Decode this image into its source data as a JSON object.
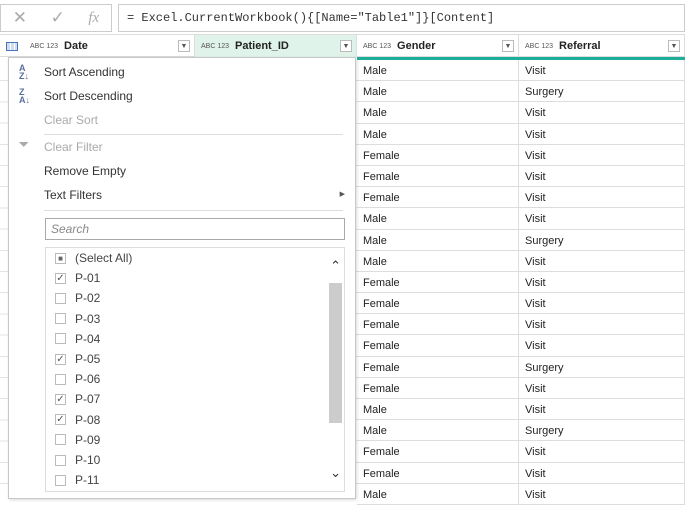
{
  "formula_bar": {
    "cancel": "✕",
    "confirm": "✓",
    "fx": "fx",
    "formula": "= Excel.CurrentWorkbook(){[Name=\"Table1\"]}[Content]"
  },
  "columns": [
    {
      "label": "Date",
      "type": "ABC 123"
    },
    {
      "label": "Patient_ID",
      "type": "ABC 123"
    },
    {
      "label": "Gender",
      "type": "ABC 123"
    },
    {
      "label": "Referral",
      "type": "ABC 123"
    }
  ],
  "menu": {
    "sort_asc": "Sort Ascending",
    "sort_desc": "Sort Descending",
    "clear_sort": "Clear Sort",
    "clear_filter": "Clear Filter",
    "remove_empty": "Remove Empty",
    "text_filters": "Text Filters",
    "search_placeholder": "Search"
  },
  "filter_items": [
    {
      "label": "(Select All)",
      "state": "partial"
    },
    {
      "label": "P-01",
      "state": "checked"
    },
    {
      "label": "P-02",
      "state": "unchecked"
    },
    {
      "label": "P-03",
      "state": "unchecked"
    },
    {
      "label": "P-04",
      "state": "unchecked"
    },
    {
      "label": "P-05",
      "state": "checked"
    },
    {
      "label": "P-06",
      "state": "unchecked"
    },
    {
      "label": "P-07",
      "state": "checked"
    },
    {
      "label": "P-08",
      "state": "checked"
    },
    {
      "label": "P-09",
      "state": "unchecked"
    },
    {
      "label": "P-10",
      "state": "unchecked"
    },
    {
      "label": "P-11",
      "state": "unchecked"
    }
  ],
  "rows": [
    [
      "Male",
      "Visit"
    ],
    [
      "Male",
      "Surgery"
    ],
    [
      "Male",
      "Visit"
    ],
    [
      "Male",
      "Visit"
    ],
    [
      "Female",
      "Visit"
    ],
    [
      "Female",
      "Visit"
    ],
    [
      "Female",
      "Visit"
    ],
    [
      "Male",
      "Visit"
    ],
    [
      "Male",
      "Surgery"
    ],
    [
      "Male",
      "Visit"
    ],
    [
      "Female",
      "Visit"
    ],
    [
      "Female",
      "Visit"
    ],
    [
      "Female",
      "Visit"
    ],
    [
      "Female",
      "Visit"
    ],
    [
      "Female",
      "Surgery"
    ],
    [
      "Female",
      "Visit"
    ],
    [
      "Male",
      "Visit"
    ],
    [
      "Male",
      "Surgery"
    ],
    [
      "Female",
      "Visit"
    ],
    [
      "Female",
      "Visit"
    ],
    [
      "Male",
      "Visit"
    ]
  ],
  "colors": {
    "accent": "#1fae9a",
    "selected_header": "#dff3ea"
  }
}
